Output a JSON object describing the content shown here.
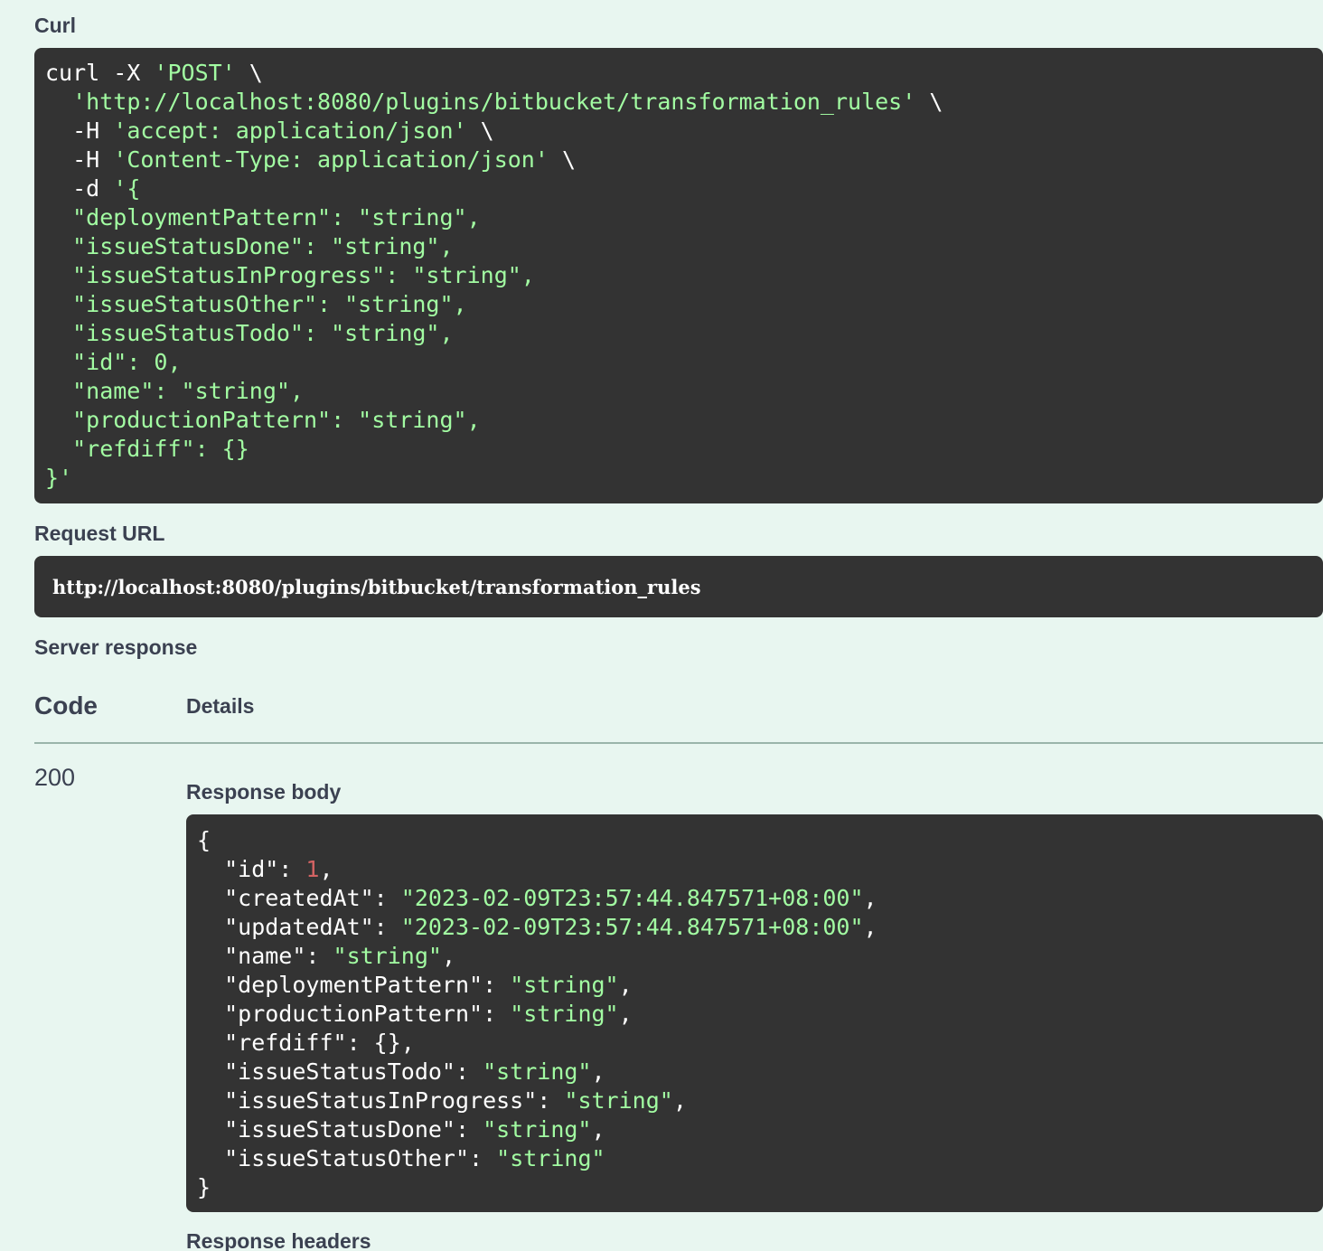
{
  "curl": {
    "label": "Curl",
    "lines": [
      [
        {
          "t": "curl -X ",
          "c": "w"
        },
        {
          "t": "'POST'",
          "c": "s"
        },
        {
          "t": " \\",
          "c": "w"
        }
      ],
      [
        {
          "t": "  ",
          "c": "w"
        },
        {
          "t": "'http://localhost:8080/plugins/bitbucket/transformation_rules'",
          "c": "s"
        },
        {
          "t": " \\",
          "c": "w"
        }
      ],
      [
        {
          "t": "  -H ",
          "c": "w"
        },
        {
          "t": "'accept: application/json'",
          "c": "s"
        },
        {
          "t": " \\",
          "c": "w"
        }
      ],
      [
        {
          "t": "  -H ",
          "c": "w"
        },
        {
          "t": "'Content-Type: application/json'",
          "c": "s"
        },
        {
          "t": " \\",
          "c": "w"
        }
      ],
      [
        {
          "t": "  -d ",
          "c": "w"
        },
        {
          "t": "'{",
          "c": "s"
        }
      ],
      [
        {
          "t": "  \"deploymentPattern\": \"string\",",
          "c": "s"
        }
      ],
      [
        {
          "t": "  \"issueStatusDone\": \"string\",",
          "c": "s"
        }
      ],
      [
        {
          "t": "  \"issueStatusInProgress\": \"string\",",
          "c": "s"
        }
      ],
      [
        {
          "t": "  \"issueStatusOther\": \"string\",",
          "c": "s"
        }
      ],
      [
        {
          "t": "  \"issueStatusTodo\": \"string\",",
          "c": "s"
        }
      ],
      [
        {
          "t": "  \"id\": 0,",
          "c": "s"
        }
      ],
      [
        {
          "t": "  \"name\": \"string\",",
          "c": "s"
        }
      ],
      [
        {
          "t": "  \"productionPattern\": \"string\",",
          "c": "s"
        }
      ],
      [
        {
          "t": "  \"refdiff\": {}",
          "c": "s"
        }
      ],
      [
        {
          "t": "}'",
          "c": "s"
        }
      ]
    ]
  },
  "request_url": {
    "label": "Request URL",
    "value": "http://localhost:8080/plugins/bitbucket/transformation_rules"
  },
  "server_response": {
    "label": "Server response",
    "columns": {
      "code": "Code",
      "details": "Details"
    },
    "status_code": "200",
    "response_body_label": "Response body",
    "response_body_lines": [
      [
        {
          "t": "{",
          "c": "w"
        }
      ],
      [
        {
          "t": "  \"id\": ",
          "c": "w"
        },
        {
          "t": "1",
          "c": "n"
        },
        {
          "t": ",",
          "c": "w"
        }
      ],
      [
        {
          "t": "  \"createdAt\": ",
          "c": "w"
        },
        {
          "t": "\"2023-02-09T23:57:44.847571+08:00\"",
          "c": "s"
        },
        {
          "t": ",",
          "c": "w"
        }
      ],
      [
        {
          "t": "  \"updatedAt\": ",
          "c": "w"
        },
        {
          "t": "\"2023-02-09T23:57:44.847571+08:00\"",
          "c": "s"
        },
        {
          "t": ",",
          "c": "w"
        }
      ],
      [
        {
          "t": "  \"name\": ",
          "c": "w"
        },
        {
          "t": "\"string\"",
          "c": "s"
        },
        {
          "t": ",",
          "c": "w"
        }
      ],
      [
        {
          "t": "  \"deploymentPattern\": ",
          "c": "w"
        },
        {
          "t": "\"string\"",
          "c": "s"
        },
        {
          "t": ",",
          "c": "w"
        }
      ],
      [
        {
          "t": "  \"productionPattern\": ",
          "c": "w"
        },
        {
          "t": "\"string\"",
          "c": "s"
        },
        {
          "t": ",",
          "c": "w"
        }
      ],
      [
        {
          "t": "  \"refdiff\": {},",
          "c": "w"
        }
      ],
      [
        {
          "t": "  \"issueStatusTodo\": ",
          "c": "w"
        },
        {
          "t": "\"string\"",
          "c": "s"
        },
        {
          "t": ",",
          "c": "w"
        }
      ],
      [
        {
          "t": "  \"issueStatusInProgress\": ",
          "c": "w"
        },
        {
          "t": "\"string\"",
          "c": "s"
        },
        {
          "t": ",",
          "c": "w"
        }
      ],
      [
        {
          "t": "  \"issueStatusDone\": ",
          "c": "w"
        },
        {
          "t": "\"string\"",
          "c": "s"
        },
        {
          "t": ",",
          "c": "w"
        }
      ],
      [
        {
          "t": "  \"issueStatusOther\": ",
          "c": "w"
        },
        {
          "t": "\"string\"",
          "c": "s"
        }
      ],
      [
        {
          "t": "}",
          "c": "w"
        }
      ]
    ],
    "response_headers_label": "Response headers"
  },
  "colors": {
    "background": "#e8f6f0",
    "code_background": "#333333",
    "string_green": "#a2fca2",
    "number_red": "#d36363",
    "label_text": "#3b4151"
  }
}
